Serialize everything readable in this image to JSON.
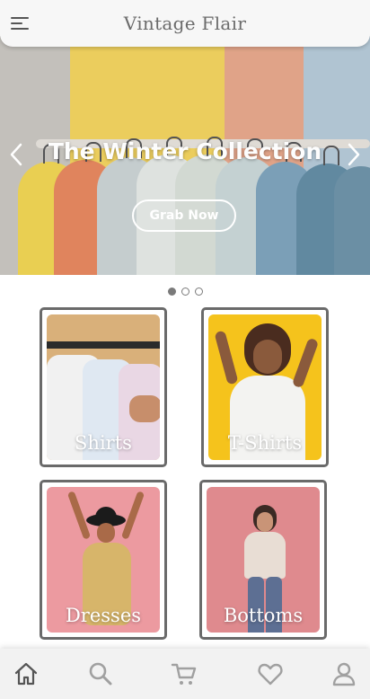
{
  "header": {
    "title": "Vintage Flair",
    "menu_icon": "menu-icon"
  },
  "hero": {
    "title": "The Winter Collection",
    "button_label": "Grab Now",
    "prev_icon": "chevron-left-icon",
    "next_icon": "chevron-right-icon",
    "slides_total": 3,
    "active_slide": 1
  },
  "categories": [
    {
      "label": "Shirts",
      "photo_bg": "#d9b07a"
    },
    {
      "label": "T-Shirts",
      "photo_bg": "#f5c31c"
    },
    {
      "label": "Dresses",
      "photo_bg": "#ec9aa0"
    },
    {
      "label": "Bottoms",
      "photo_bg": "#df8a8e"
    }
  ],
  "bottom_nav": [
    {
      "name": "home",
      "icon": "home-icon",
      "active": true
    },
    {
      "name": "search",
      "icon": "search-icon",
      "active": false
    },
    {
      "name": "cart",
      "icon": "cart-icon",
      "active": false
    },
    {
      "name": "wishlist",
      "icon": "heart-icon",
      "active": false
    },
    {
      "name": "profile",
      "icon": "user-icon",
      "active": false
    }
  ],
  "colors": {
    "accent": "#6a6a6a",
    "nav_inactive": "#a0a0a0",
    "nav_active": "#555555"
  }
}
